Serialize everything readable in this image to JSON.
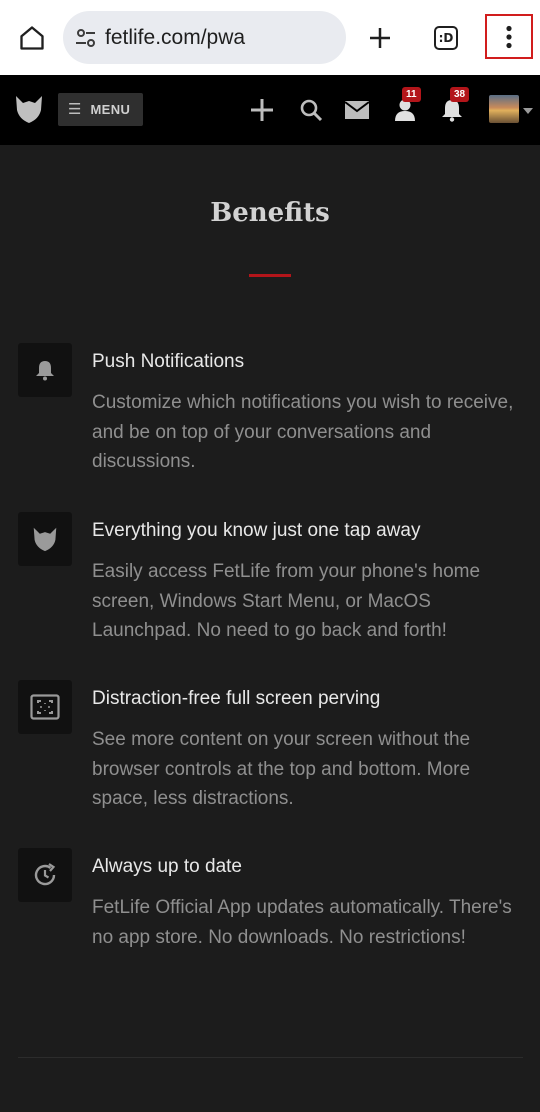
{
  "browser": {
    "url": "fetlife.com/pwa",
    "icons": {
      "home": "home-icon",
      "site_info": "tune-icon",
      "new_tab": "plus-icon",
      "tab_switcher": "tab-switcher-icon",
      "more": "more-vert-icon"
    },
    "tab_switcher_label": ":D"
  },
  "header": {
    "menu_label": "MENU",
    "icons": [
      "plus-icon",
      "search-icon",
      "mail-icon",
      "user-icon",
      "bell-icon"
    ],
    "friends_badge": "11",
    "notifications_badge": "38"
  },
  "page": {
    "title": "Benefits",
    "accent_color": "#b3151a",
    "benefits": [
      {
        "icon": "bell-icon",
        "title": "Push Notifications",
        "description": "Customize which notifications you wish to receive, and be on top of your conversations and discussions."
      },
      {
        "icon": "fetlife-logo-icon",
        "title": "Everything you know just one tap away",
        "description": "Easily access FetLife from your phone's home screen, Windows Start Menu, or MacOS Launchpad. No need to go back and forth!"
      },
      {
        "icon": "fullscreen-icon",
        "title": "Distraction-free full screen perving",
        "description": "See more content on your screen without the browser controls at the top and bottom. More space, less distractions."
      },
      {
        "icon": "update-icon",
        "title": "Always up to date",
        "description": "FetLife Official App updates automatically. There's no app store. No downloads. No restrictions!"
      }
    ]
  }
}
